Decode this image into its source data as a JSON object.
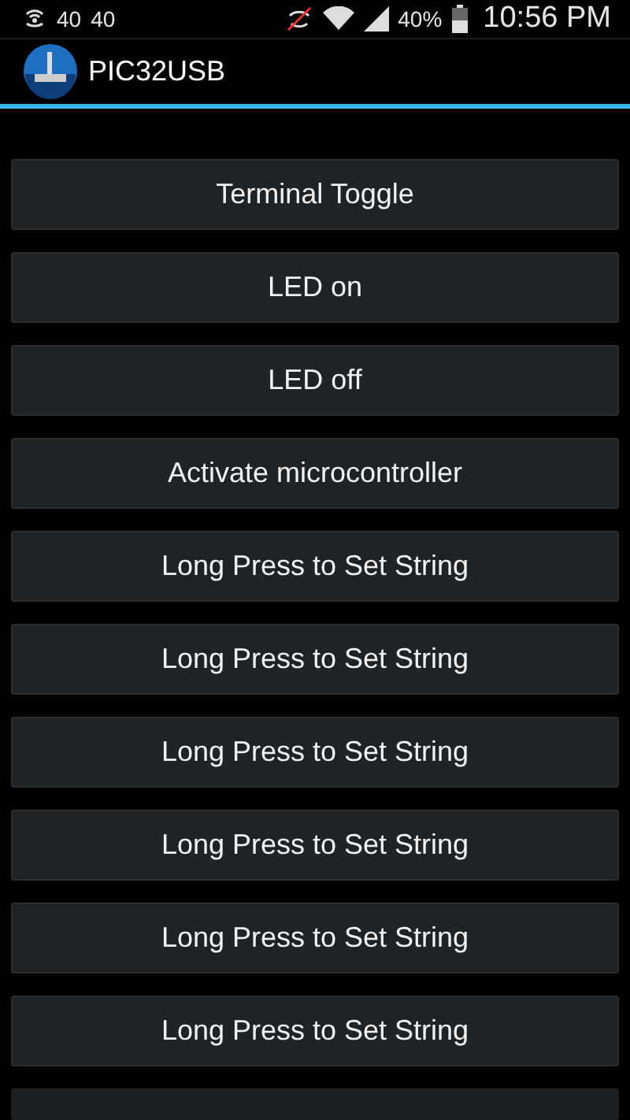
{
  "status_bar": {
    "left_texts": [
      "40",
      "40"
    ],
    "battery_text": "40%",
    "time": "10:56 PM"
  },
  "action_bar": {
    "title": "PIC32USB"
  },
  "buttons": [
    "Terminal Toggle",
    "LED on",
    "LED off",
    "Activate microcontroller",
    "Long Press to Set String",
    "Long Press to Set String",
    "Long Press to Set String",
    "Long Press to Set String",
    "Long Press to Set String",
    "Long Press to Set String"
  ]
}
